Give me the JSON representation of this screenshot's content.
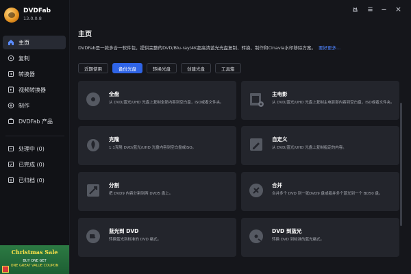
{
  "app": {
    "name": "DVDFab",
    "version": "13.0.0.8"
  },
  "window_controls": [
    "theme-icon",
    "menu-icon",
    "minimize-icon",
    "close-icon"
  ],
  "sidebar": {
    "items": [
      {
        "label": "主页",
        "icon": "home-icon"
      },
      {
        "label": "复制",
        "icon": "copy-icon"
      },
      {
        "label": "转换器",
        "icon": "ripper-icon"
      },
      {
        "label": "视频转换器",
        "icon": "video-converter-icon"
      },
      {
        "label": "制作",
        "icon": "creator-icon"
      },
      {
        "label": "DVDFab 产品",
        "icon": "products-icon"
      }
    ],
    "status": [
      {
        "label": "处理中 (0)",
        "icon": "processing-icon"
      },
      {
        "label": "已完成 (0)",
        "icon": "completed-icon"
      },
      {
        "label": "已归档 (0)",
        "icon": "archived-icon"
      }
    ],
    "promo": {
      "title": "Christmas Sale",
      "line1": "BUY ONE GET",
      "line2": "ONE GREAT VALUE COUPON"
    }
  },
  "main": {
    "title": "主页",
    "description": "DVDFab是一款多合一软件包，提供完整的DVD/Blu-ray/4K超高清蓝光光盘复制、转换、制作和Cinavia水印移除方案。",
    "learn_more": "要好更多...",
    "tabs": [
      "近期使用",
      "备份光盘",
      "转换光盘",
      "创建光盘",
      "工具箱"
    ],
    "active_tab": "备份光盘",
    "cards": [
      {
        "title": "全盘",
        "desc": "从 DVD/蓝光/UHD 光盘上复制全部内容到空白盘，ISO或者文件夹。",
        "icon": "disc-icon"
      },
      {
        "title": "主电影",
        "desc": "从 DVD/蓝光/UHD 光盘上复制主电影部内容到空白盘，ISO或者文件夹。",
        "icon": "film-icon"
      },
      {
        "title": "克隆",
        "desc": "1:1克隆 DVD/蓝光/UHD 光盘内容到空白盘或ISO。",
        "icon": "clone-icon"
      },
      {
        "title": "自定义",
        "desc": "从 DVD/蓝光/UHD 光盘上复制指定的内容。",
        "icon": "customize-icon"
      },
      {
        "title": "分割",
        "desc": "把 DVD9 内容分割到两 DVD5 盘上。",
        "icon": "split-icon"
      },
      {
        "title": "合并",
        "desc": "合并多个 DVD 到一张DVD9 盘或者并多个蓝光到一个 BD50 盘。",
        "icon": "merge-icon"
      },
      {
        "title": "蓝光到 DVD",
        "desc": "转换蓝光到标准的 DVD 格式。",
        "icon": "bluray-to-dvd-icon"
      },
      {
        "title": "DVD 到蓝光",
        "desc": "转换 DVD 到标准的蓝光格式。",
        "icon": "dvd-to-bluray-icon"
      }
    ]
  },
  "colors": {
    "accent": "#2f64e6",
    "link": "#4f84ff",
    "background": "#15161b",
    "card": "#23252c"
  }
}
